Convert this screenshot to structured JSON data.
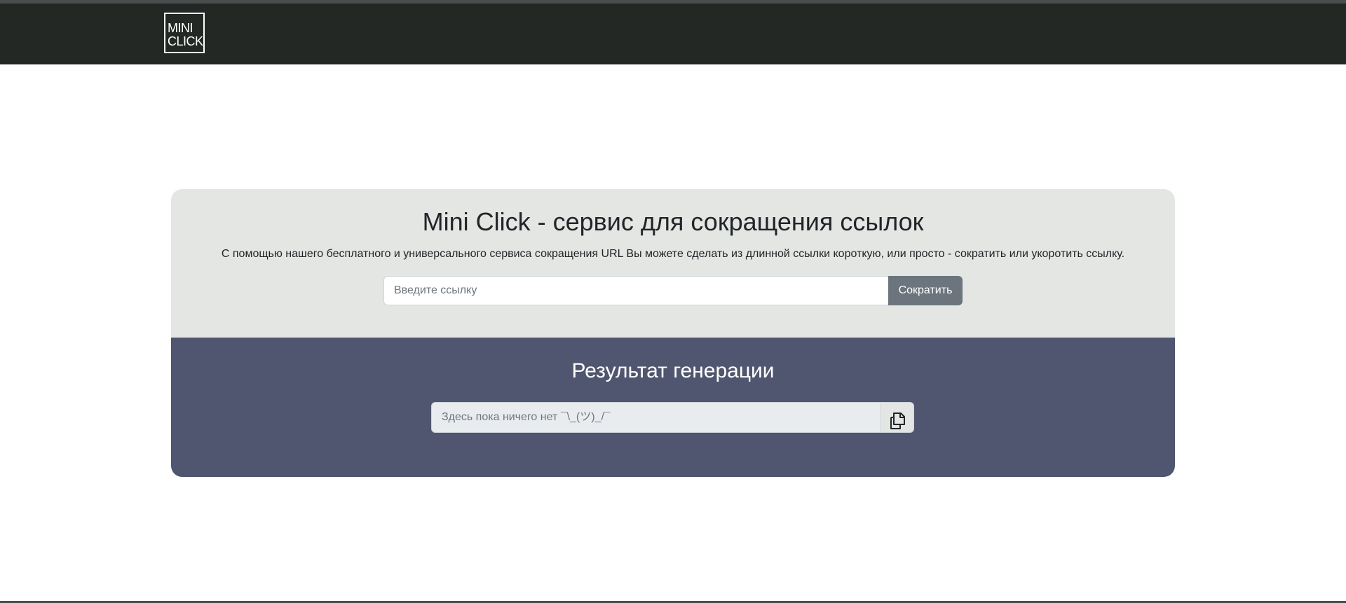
{
  "header": {
    "logo_line1": "MINI",
    "logo_line2": "CLICK"
  },
  "main": {
    "title": "Mini Click - сервис для сокращения ссылок",
    "description": "С помощью нашего бесплатного и универсального сервиса сокращения URL Вы можете сделать из длинной ссылки короткую, или просто - сократить или укоротить ссылку.",
    "url_input": {
      "value": "",
      "placeholder": "Введите ссылку"
    },
    "shorten_button_label": "Сократить"
  },
  "result": {
    "title": "Результат генерации",
    "output": {
      "value": "",
      "placeholder": "Здесь пока ничего нет ¯\\_(ツ)_/¯"
    },
    "copy_icon": "copy-icon"
  },
  "colors": {
    "navbar_bg": "#232825",
    "card_top_bg": "#e4e6e3",
    "card_bottom_bg": "#50566f",
    "button_bg": "#6c757d"
  }
}
